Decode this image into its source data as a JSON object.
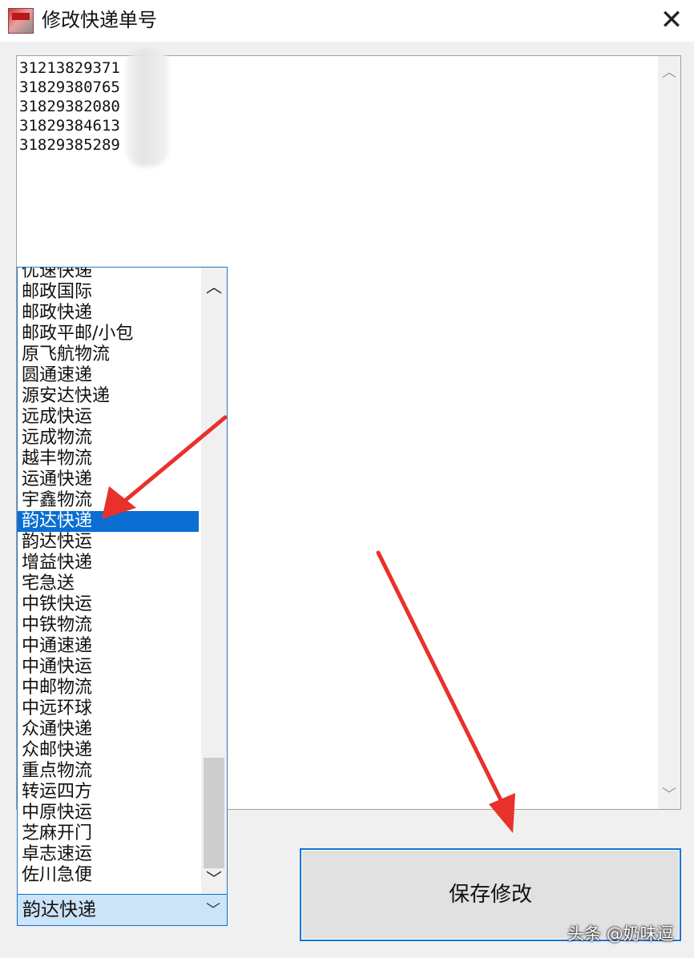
{
  "window": {
    "title": "修改快递单号",
    "close_glyph": "✕"
  },
  "tracking_numbers": [
    "31213829371",
    "31829380765",
    "31829382080",
    "31829384613",
    "31829385289"
  ],
  "courier_list": {
    "items": [
      "优速快递",
      "邮政国际",
      "邮政快递",
      "邮政平邮/小包",
      "原飞航物流",
      "圆通速递",
      "源安达快递",
      "远成快运",
      "远成物流",
      "越丰物流",
      "运通快递",
      "宇鑫物流",
      "韵达快递",
      "韵达快运",
      "增益快递",
      "宅急送",
      "中铁快运",
      "中铁物流",
      "中通速递",
      "中通快运",
      "中邮物流",
      "中远环球",
      "众通快递",
      "众邮快递",
      "重点物流",
      "转运四方",
      "中原快运",
      "芝麻开门",
      "卓志速运",
      "佐川急便"
    ],
    "selected_index": 12
  },
  "combo": {
    "value": "韵达快递"
  },
  "save_button": {
    "label": "保存修改"
  },
  "watermark": "头条 @奶味逗",
  "colors": {
    "selection": "#0a6ed2",
    "accent_border": "#1075d8",
    "annotation_arrow": "#e8312a"
  }
}
